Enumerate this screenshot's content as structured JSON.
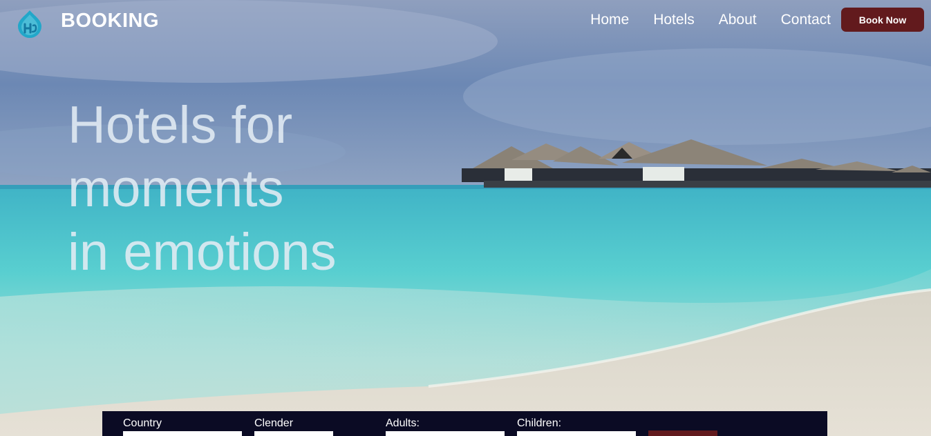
{
  "navbar": {
    "brand": "BOOKING",
    "links": [
      "Home",
      "Hotels",
      "About",
      "Contact"
    ],
    "cta_label": "Book Now"
  },
  "hero": {
    "headline_lines": [
      "Hotels for",
      "moments",
      "in emotions"
    ]
  },
  "booking_form": {
    "fields": [
      {
        "label": "Country",
        "value": ""
      },
      {
        "label": "Clender",
        "value": ""
      },
      {
        "label": "Adults:",
        "value": ""
      },
      {
        "label": "Children:",
        "value": ""
      }
    ],
    "search_label": ""
  },
  "colors": {
    "accent": "#621a1d",
    "bar_bg": "#0b0b24",
    "logo": "#22a7c9"
  },
  "icons": {
    "logo": "hotel-drop-logo-icon"
  }
}
